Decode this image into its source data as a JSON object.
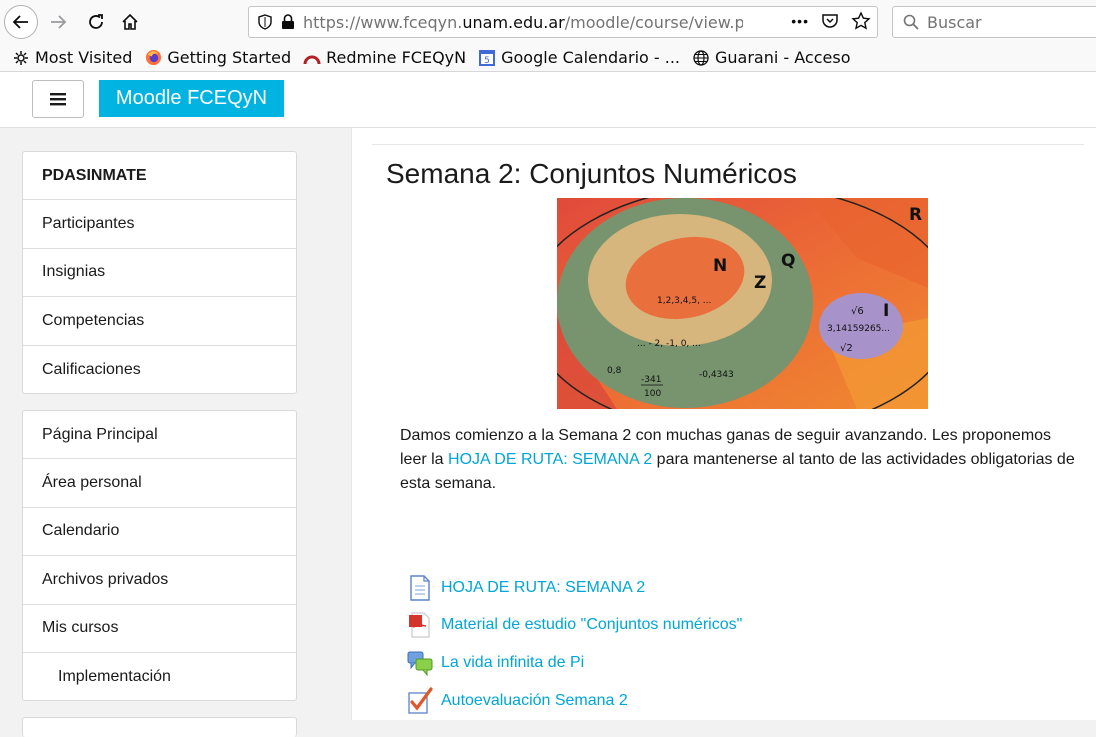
{
  "browser": {
    "url_prefix": "https://www.fceqyn.",
    "url_domain": "unam.edu.ar",
    "url_suffix": "/moodle/course/view.ph",
    "search_placeholder": "Buscar",
    "more_glyph": "•••",
    "bookmarks": [
      {
        "label": "Most Visited",
        "icon": "gear-icon"
      },
      {
        "label": "Getting Started",
        "icon": "firefox-icon"
      },
      {
        "label": "Redmine FCEQyN",
        "icon": "redmine-icon"
      },
      {
        "label": "Google Calendario - ...",
        "icon": "calendar-icon"
      },
      {
        "label": "Guarani - Acceso",
        "icon": "globe-icon"
      }
    ]
  },
  "navbar": {
    "brand": "Moodle FCEQyN"
  },
  "drawer": {
    "course_block": [
      "PDASINMATE",
      "Participantes",
      "Insignias",
      "Competencias",
      "Calificaciones"
    ],
    "nav_block": [
      "Página Principal",
      "Área personal",
      "Calendario",
      "Archivos privados",
      "Mis cursos",
      "Implementación"
    ]
  },
  "section": {
    "title": "Semana 2: Conjuntos Numéricos",
    "banner": {
      "R": "R",
      "Q": "Q",
      "Z": "Z",
      "N": "N",
      "I": "I",
      "n_values": "1,2,3,4,5, ...",
      "z_values": "... - 2, -1, 0, ...",
      "q_a": "0,8",
      "q_num": "-341",
      "q_den": "100",
      "q_b": "-0,4343",
      "i_a": "√6",
      "i_b": "3,14159265...",
      "i_c": "√2"
    },
    "summary_before": "Damos comienzo a la Semana 2 con muchas ganas de seguir avanzando. Les proponemos leer la ",
    "summary_link": "HOJA DE RUTA: SEMANA 2",
    "summary_after": " para mantenerse al tanto de las actividades obligatorias de esta semana.",
    "activities": [
      {
        "label": "HOJA DE RUTA: SEMANA 2",
        "icon": "page-icon"
      },
      {
        "label": "Material de estudio \"Conjuntos numéricos\"",
        "icon": "pdf-icon"
      },
      {
        "label": "La vida infinita de Pi",
        "icon": "forum-icon"
      },
      {
        "label": "Autoevaluación Semana 2",
        "icon": "quiz-icon"
      }
    ]
  },
  "colors": {
    "brand": "#00b3e0",
    "link": "#00a6d6"
  }
}
